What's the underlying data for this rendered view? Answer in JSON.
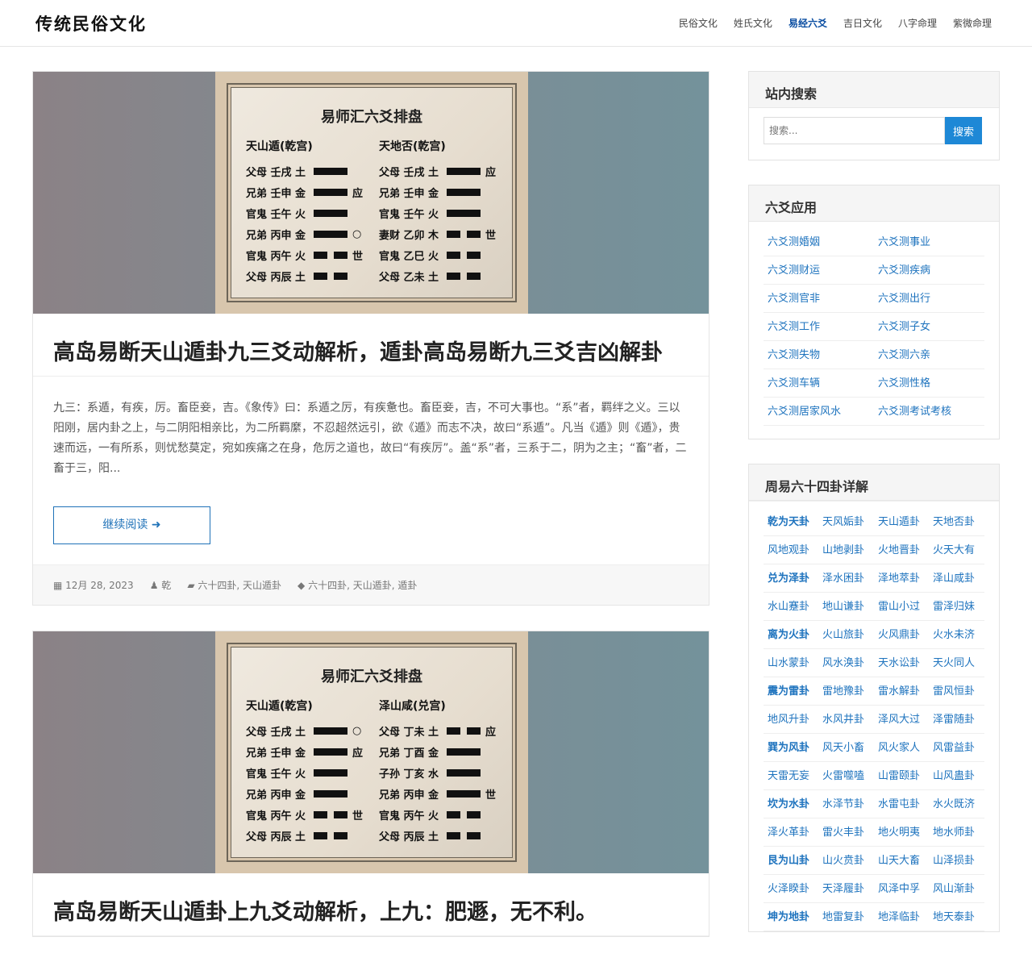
{
  "site": {
    "logo": "传统民俗文化",
    "nav": [
      "民俗文化",
      "姓氏文化",
      "易经六爻",
      "吉日文化",
      "八字命理",
      "紫微命理"
    ],
    "active_nav": 2
  },
  "posts": [
    {
      "chart": {
        "title": "易师汇六爻排盘",
        "left": {
          "name": "天山遁(乾宫)",
          "lines": [
            {
              "l": "父母 壬戌 土",
              "y": "yang",
              "m": ""
            },
            {
              "l": "兄弟 壬申 金",
              "y": "yang",
              "m": "应"
            },
            {
              "l": "官鬼 壬午 火",
              "y": "yang",
              "m": ""
            },
            {
              "l": "兄弟 丙申 金",
              "y": "yang",
              "m": "○"
            },
            {
              "l": "官鬼 丙午 火",
              "y": "yin",
              "m": "世"
            },
            {
              "l": "父母 丙辰 土",
              "y": "yin",
              "m": ""
            }
          ]
        },
        "right": {
          "name": "天地否(乾宫)",
          "lines": [
            {
              "l": "父母 壬戌 土",
              "y": "yang",
              "m": "应"
            },
            {
              "l": "兄弟 壬申 金",
              "y": "yang",
              "m": ""
            },
            {
              "l": "官鬼 壬午 火",
              "y": "yang",
              "m": ""
            },
            {
              "l": "妻财 乙卯 木",
              "y": "yin",
              "m": "世"
            },
            {
              "l": "官鬼 乙巳 火",
              "y": "yin",
              "m": ""
            },
            {
              "l": "父母 乙未 土",
              "y": "yin",
              "m": ""
            }
          ]
        }
      },
      "title": "高岛易断天山遁卦九三爻动解析，遁卦高岛易断九三爻吉凶解卦",
      "excerpt": "九三：系遁，有疾，厉。畜臣妾，吉。《象传》曰：系遁之厉，有疾惫也。畜臣妾，吉，不可大事也。“系”者，羁绊之义。三以阳刚，居内卦之上，与二阴阳相亲比，为二所羁縻，不忍超然远引，欲《遁》而志不决，故曰“系遁”。凡当《遁》则《遁》，贵速而远，一有所系，则忧愁莫定，宛如疾痛之在身，危厉之道也，故曰“有疾厉”。盖“系”者，三系于二，阴为之主；“畜”者，二畜于三，阳...",
      "more": "继续阅读",
      "date": "12月 28, 2023",
      "author": "乾",
      "categories": "六十四卦, 天山遁卦",
      "tags": "六十四卦, 天山遁卦, 遁卦"
    },
    {
      "chart": {
        "title": "易师汇六爻排盘",
        "left": {
          "name": "天山遁(乾宫)",
          "lines": [
            {
              "l": "父母 壬戌 土",
              "y": "yang",
              "m": "○"
            },
            {
              "l": "兄弟 壬申 金",
              "y": "yang",
              "m": "应"
            },
            {
              "l": "官鬼 壬午 火",
              "y": "yang",
              "m": ""
            },
            {
              "l": "兄弟 丙申 金",
              "y": "yang",
              "m": ""
            },
            {
              "l": "官鬼 丙午 火",
              "y": "yin",
              "m": "世"
            },
            {
              "l": "父母 丙辰 土",
              "y": "yin",
              "m": ""
            }
          ]
        },
        "right": {
          "name": "泽山咸(兑宫)",
          "lines": [
            {
              "l": "父母 丁未 土",
              "y": "yin",
              "m": "应"
            },
            {
              "l": "兄弟 丁酉 金",
              "y": "yang",
              "m": ""
            },
            {
              "l": "子孙 丁亥 水",
              "y": "yang",
              "m": ""
            },
            {
              "l": "兄弟 丙申 金",
              "y": "yang",
              "m": "世"
            },
            {
              "l": "官鬼 丙午 火",
              "y": "yin",
              "m": ""
            },
            {
              "l": "父母 丙辰 土",
              "y": "yin",
              "m": ""
            }
          ]
        }
      },
      "title": "高岛易断天山遁卦上九爻动解析，上九：肥遯，无不利。"
    }
  ],
  "sidebar": {
    "search": {
      "title": "站内搜索",
      "placeholder": "搜索...",
      "button": "搜索"
    },
    "liuyao": {
      "title": "六爻应用",
      "items": [
        "六爻测婚姻",
        "六爻测事业",
        "六爻测财运",
        "六爻测疾病",
        "六爻测官非",
        "六爻测出行",
        "六爻测工作",
        "六爻测子女",
        "六爻测失物",
        "六爻测六亲",
        "六爻测车辆",
        "六爻测性格",
        "六爻测居家风水",
        "六爻测考试考核"
      ]
    },
    "gua": {
      "title": "周易六十四卦详解",
      "items": [
        "乾为天卦",
        "天风姤卦",
        "天山遁卦",
        "天地否卦",
        "风地观卦",
        "山地剥卦",
        "火地晋卦",
        "火天大有",
        "兑为泽卦",
        "泽水困卦",
        "泽地萃卦",
        "泽山咸卦",
        "水山蹇卦",
        "地山谦卦",
        "雷山小过",
        "雷泽归妹",
        "离为火卦",
        "火山旅卦",
        "火风鼎卦",
        "火水未济",
        "山水蒙卦",
        "风水涣卦",
        "天水讼卦",
        "天火同人",
        "震为雷卦",
        "雷地豫卦",
        "雷水解卦",
        "雷风恒卦",
        "地风升卦",
        "水风井卦",
        "泽风大过",
        "泽雷随卦",
        "巽为风卦",
        "风天小畜",
        "风火家人",
        "风雷益卦",
        "天雷无妄",
        "火雷噬嗑",
        "山雷颐卦",
        "山风蛊卦",
        "坎为水卦",
        "水泽节卦",
        "水雷屯卦",
        "水火既济",
        "泽火革卦",
        "雷火丰卦",
        "地火明夷",
        "地水师卦",
        "艮为山卦",
        "山火贲卦",
        "山天大畜",
        "山泽损卦",
        "火泽睽卦",
        "天泽履卦",
        "风泽中孚",
        "风山渐卦",
        "坤为地卦",
        "地雷复卦",
        "地泽临卦",
        "地天泰卦"
      ]
    }
  },
  "colors": {
    "link": "#1e73be",
    "button": "#1e88d6",
    "nav_active": "#0b4ea2"
  }
}
